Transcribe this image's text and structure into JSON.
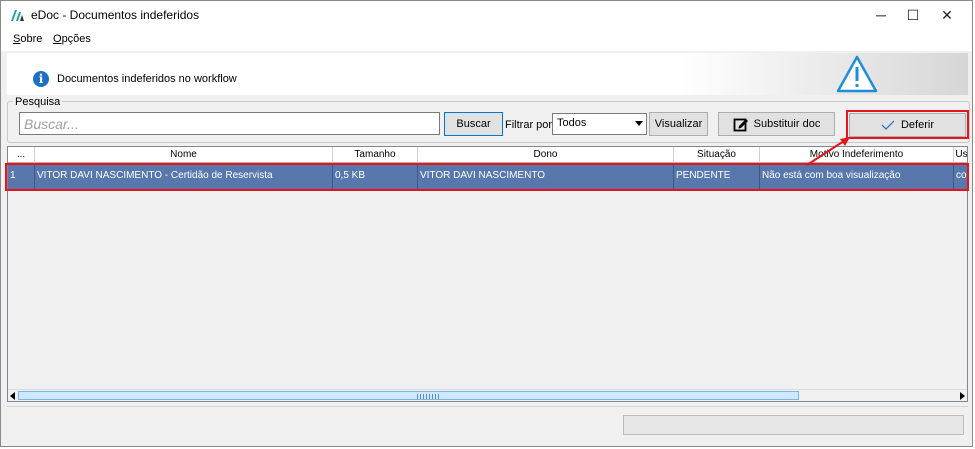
{
  "window": {
    "title": "eDoc - Documentos indeferidos",
    "controls": {
      "minimize": "─",
      "maximize": "☐",
      "close": "✕"
    }
  },
  "menu": {
    "items": [
      {
        "label_mn": "S",
        "label_rest": "obre"
      },
      {
        "label_mn": "O",
        "label_rest": "pções"
      }
    ]
  },
  "banner": {
    "info_icon": "info-icon",
    "info_glyph": "i",
    "text": "Documentos indeferidos no workflow",
    "warning_icon": "warning-triangle-icon",
    "warning_color": "#1e8fd6"
  },
  "search": {
    "group_label": "Pesquisa",
    "placeholder": "Buscar...",
    "value": "",
    "search_button": "Buscar",
    "filter_label": "Filtrar por:",
    "filter_selected": "Todos",
    "view_button": "Visualizar",
    "replace_button": "Substituir doc",
    "replace_icon": "edit-document-icon",
    "approve_button": "Deferir",
    "approve_icon": "checkmark-icon"
  },
  "grid": {
    "columns": [
      "...",
      "Nome",
      "Tamanho",
      "Dono",
      "Situação",
      "Motivo Indeferimento",
      "Us"
    ],
    "rows": [
      [
        "1",
        "VITOR DAVI NASCIMENTO - Certidão de Reservista",
        "0,5 KB",
        "VITOR DAVI NASCIMENTO",
        "PENDENTE",
        "Não está com boa visualização",
        "co"
      ]
    ],
    "selected_row_color": "#5777ad"
  },
  "annotation": {
    "highlight_color": "#e8141b"
  }
}
